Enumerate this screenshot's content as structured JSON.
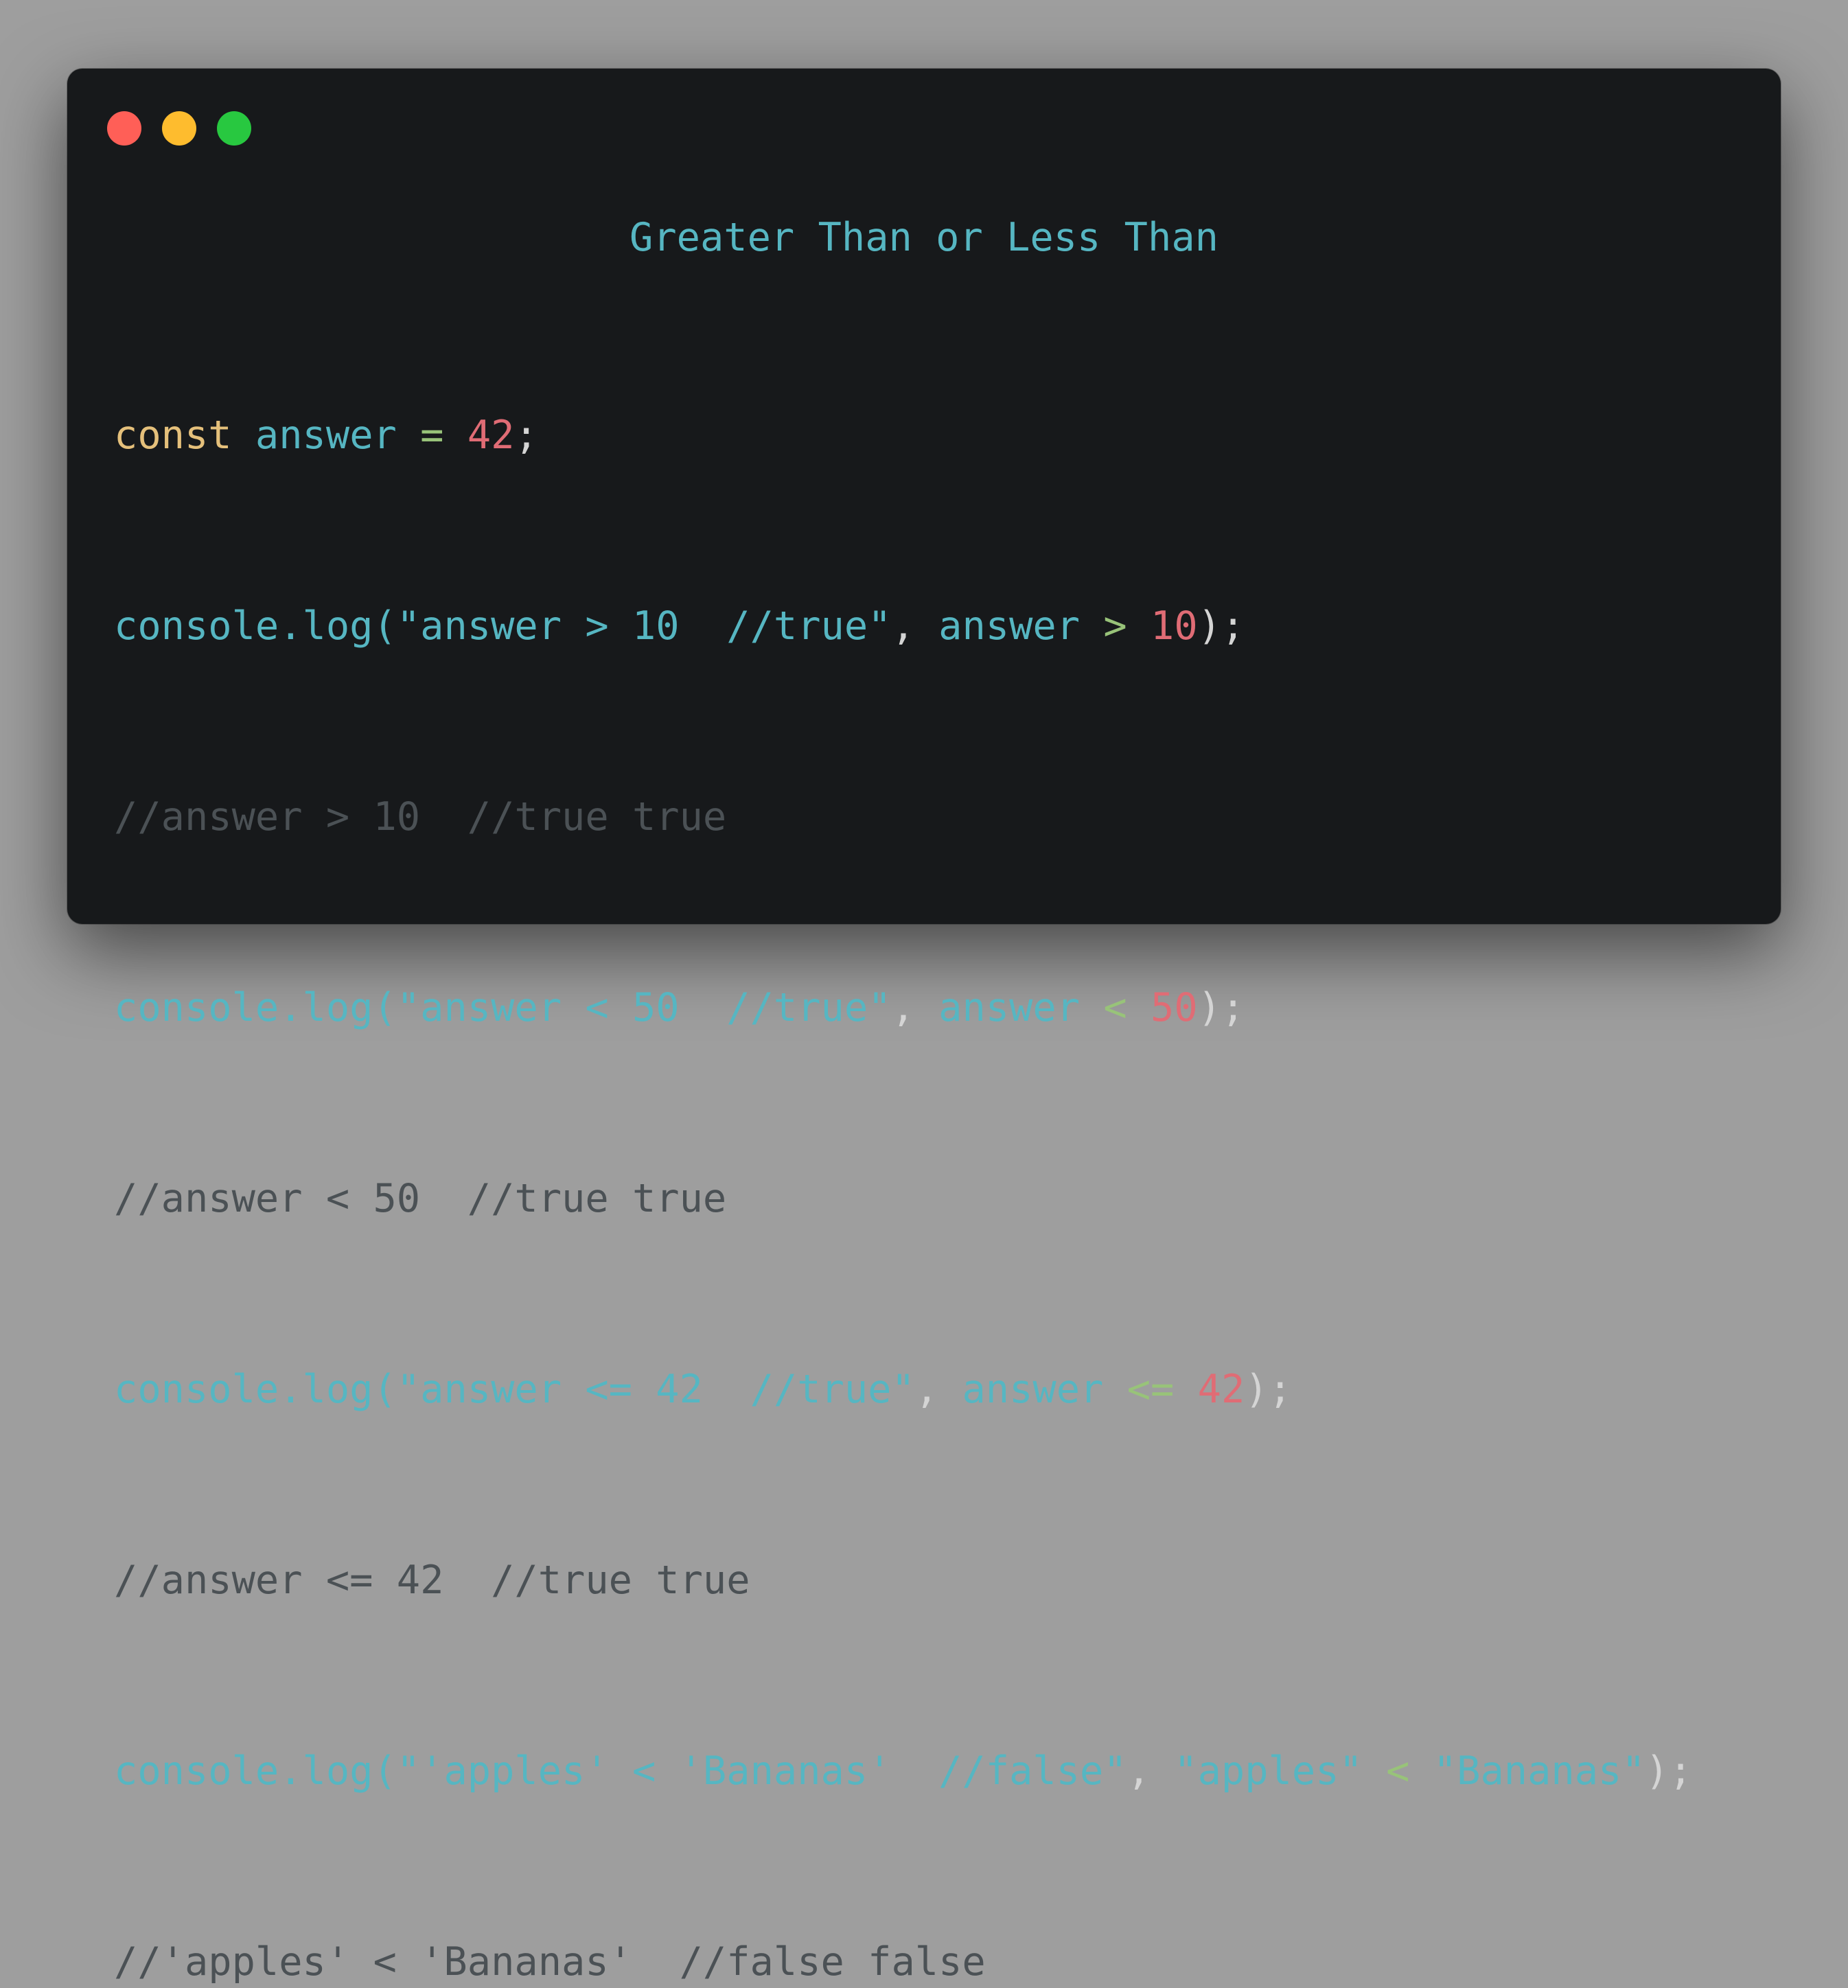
{
  "window": {
    "title": "Greater Than or Less Than"
  },
  "code": {
    "l1": {
      "kw": "const",
      "var": "answer",
      "op": "=",
      "num": "42",
      "end": ";"
    },
    "l2": {
      "fn": "console.log(",
      "str": "\"answer > 10  //true\"",
      "comma": ",",
      "var": "answer",
      "op": ">",
      "num": "10",
      "end": ");"
    },
    "l3": {
      "comment": "//answer > 10  //true true"
    },
    "l4": {
      "fn": "console.log(",
      "str": "\"answer < 50  //true\"",
      "comma": ",",
      "var": "answer",
      "op": "<",
      "num": "50",
      "end": ");"
    },
    "l5": {
      "comment": "//answer < 50  //true true"
    },
    "l6": {
      "fn": "console.log(",
      "str": "\"answer <= 42  //true\"",
      "comma": ",",
      "var": "answer",
      "op": "<=",
      "num": "42",
      "end": ");"
    },
    "l7": {
      "comment": "//answer <= 42  //true true"
    },
    "l8": {
      "fn": "console.log(",
      "str": "\"'apples' < 'Bananas'  //false\"",
      "comma": ",",
      "str2": "\"apples\"",
      "op": "<",
      "str3": "\"Bananas\"",
      "end": ");"
    },
    "l9": {
      "comment": "//'apples' < 'Bananas'  //false false"
    }
  },
  "colors": {
    "window_bg": "#17191b",
    "page_bg": "#9e9e9e",
    "keyword": "#e5c07b",
    "identifier": "#56b6c2",
    "operator": "#98c379",
    "number": "#e06c75",
    "comment": "#4b5155"
  }
}
